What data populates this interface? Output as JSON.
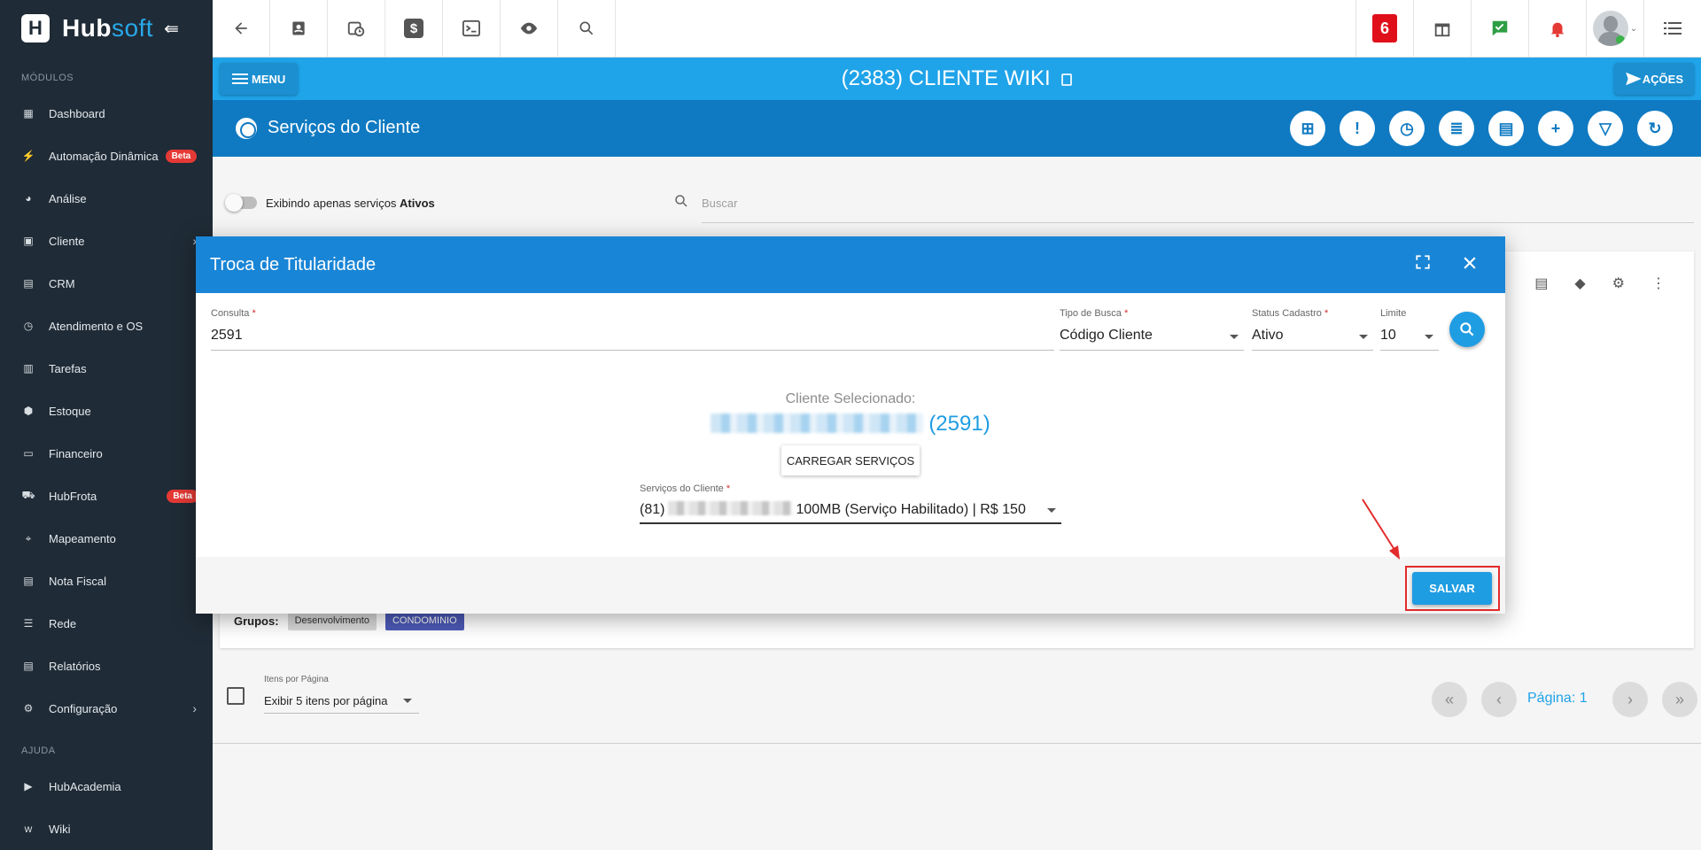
{
  "brand": {
    "name_part1": "Hub",
    "name_part2": "soft",
    "logo_glyph": "H"
  },
  "sidebar": {
    "section_modules": "MÓDULOS",
    "items": [
      {
        "label": "Dashboard",
        "icon": "dashboard-icon",
        "glyph": "▦"
      },
      {
        "label": "Automação Dinâmica",
        "icon": "automation-icon",
        "glyph": "⚡",
        "badge": "Beta"
      },
      {
        "label": "Análise",
        "icon": "analytics-icon",
        "glyph": "◕"
      },
      {
        "label": "Cliente",
        "icon": "client-icon",
        "glyph": "▣",
        "has_arrow": true
      },
      {
        "label": "CRM",
        "icon": "crm-icon",
        "glyph": "▤"
      },
      {
        "label": "Atendimento e OS",
        "icon": "calendar-clock-icon",
        "glyph": "◷"
      },
      {
        "label": "Tarefas",
        "icon": "tasks-icon",
        "glyph": "▥"
      },
      {
        "label": "Estoque",
        "icon": "box-icon",
        "glyph": "⬢"
      },
      {
        "label": "Financeiro",
        "icon": "money-icon",
        "glyph": "▭"
      },
      {
        "label": "HubFrota",
        "icon": "car-icon",
        "glyph": "⛟",
        "badge": "Beta",
        "badge_right": true
      },
      {
        "label": "Mapeamento",
        "icon": "map-pin-icon",
        "glyph": "⌖"
      },
      {
        "label": "Nota Fiscal",
        "icon": "receipt-icon",
        "glyph": "▤"
      },
      {
        "label": "Rede",
        "icon": "server-icon",
        "glyph": "☰"
      },
      {
        "label": "Relatórios",
        "icon": "report-icon",
        "glyph": "▤"
      },
      {
        "label": "Configuração",
        "icon": "gear-icon",
        "glyph": "⚙",
        "has_arrow": true
      }
    ],
    "section_help": "AJUDA",
    "help_items": [
      {
        "label": "HubAcademia",
        "icon": "video-icon",
        "glyph": "▶"
      },
      {
        "label": "Wiki",
        "icon": "wiki-icon",
        "glyph": "w"
      }
    ]
  },
  "topbar": {
    "notification_count": "6"
  },
  "header": {
    "menu_label": "MENU",
    "client_title": "(2383) CLIENTE WIKI",
    "actions_label": "AÇÕES"
  },
  "services": {
    "title": "Serviços do Cliente",
    "filter_label": "Exibindo apenas serviços ",
    "filter_bold": "Ativos",
    "search_placeholder": "Buscar"
  },
  "card": {
    "groups_label": "Grupos:",
    "groups": [
      "Desenvolvimento",
      "CONDOMINIO"
    ]
  },
  "pager": {
    "items_per_page_label": "Itens por Página",
    "items_per_page_value": "Exibir 5 itens por página",
    "page_label": "Página: 1"
  },
  "modal": {
    "title": "Troca de Titularidade",
    "consulta_label": "Consulta",
    "consulta_value": "2591",
    "tipo_label": "Tipo de Busca",
    "tipo_value": "Código Cliente",
    "status_label": "Status Cadastro",
    "status_value": "Ativo",
    "limite_label": "Limite",
    "limite_value": "10",
    "selected_label": "Cliente Selecionado:",
    "selected_code": "(2591)",
    "load_button": "CARREGAR SERVIÇOS",
    "services_label": "Serviços do Cliente",
    "services_value_prefix": "(81)",
    "services_value_suffix": "100MB (Serviço Habilitado) | R$ 150",
    "save_button": "SALVAR"
  },
  "colors": {
    "primary": "#1fa3e9",
    "dark_primary": "#0f7ac2",
    "sidebar": "#1f2b36",
    "highlight": "#e22b2b"
  }
}
